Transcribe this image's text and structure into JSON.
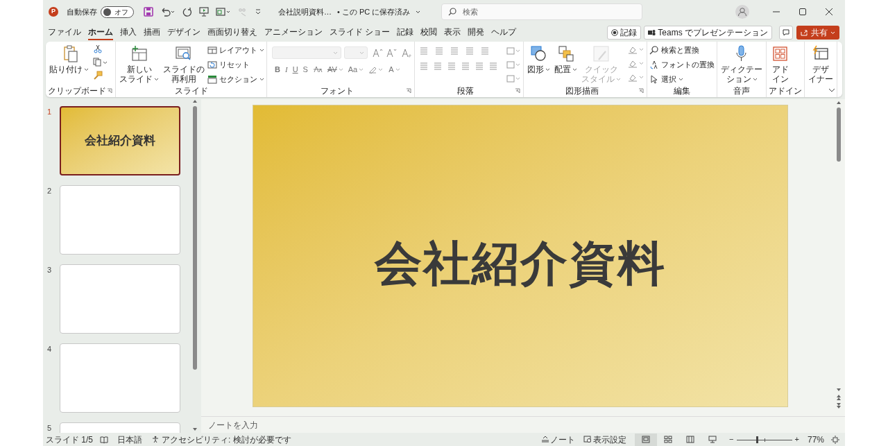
{
  "title_bar": {
    "logo_letter": "P",
    "autosave": {
      "label": "自動保存",
      "on": false,
      "state_label": "オフ"
    },
    "document": {
      "title": "会社説明資料…",
      "save_status": "• この PC に保存済み"
    },
    "search": {
      "placeholder": "検索"
    }
  },
  "tabs": [
    {
      "label": "ファイル",
      "selected": false
    },
    {
      "label": "ホーム",
      "selected": true
    },
    {
      "label": "挿入",
      "selected": false
    },
    {
      "label": "描画",
      "selected": false
    },
    {
      "label": "デザイン",
      "selected": false
    },
    {
      "label": "画面切り替え",
      "selected": false
    },
    {
      "label": "アニメーション",
      "selected": false
    },
    {
      "label": "スライド ショー",
      "selected": false
    },
    {
      "label": "記録",
      "selected": false
    },
    {
      "label": "校閲",
      "selected": false
    },
    {
      "label": "表示",
      "selected": false
    },
    {
      "label": "開発",
      "selected": false
    },
    {
      "label": "ヘルプ",
      "selected": false
    }
  ],
  "ribbon_actions": [
    {
      "kind": "record",
      "label": "記録"
    },
    {
      "kind": "teams",
      "label": "Teams でプレゼンテーション"
    },
    {
      "kind": "comment"
    },
    {
      "kind": "share",
      "label": "共有"
    }
  ],
  "ribbon": {
    "groups": [
      {
        "label": "クリップボード",
        "launcher": true,
        "items": [
          {
            "kind": "large",
            "lines": [
              "貼り付け"
            ],
            "dropdown": true,
            "disabled": false
          },
          {
            "kind": "clipboard_tools"
          }
        ]
      },
      {
        "label": "スライド",
        "launcher": false,
        "items": [
          {
            "kind": "large",
            "lines": [
              "新しい",
              "スライド"
            ],
            "dropdown": true,
            "disabled": false
          },
          {
            "kind": "large",
            "lines": [
              "スライドの",
              "再利用"
            ],
            "dropdown": false,
            "disabled": false
          },
          {
            "kind": "small_column",
            "entries": [
              {
                "label": "レイアウト",
                "dropdown": true
              },
              {
                "label": "リセット",
                "dropdown": false
              },
              {
                "label": "セクション",
                "dropdown": true
              }
            ]
          }
        ]
      },
      {
        "label": "フォント",
        "launcher": true,
        "items": [
          {
            "kind": "font_controls",
            "glyphs": [
              "B",
              "I",
              "U",
              "S",
              "AV",
              "Aa",
              "A"
            ]
          }
        ]
      },
      {
        "label": "段落",
        "launcher": true,
        "items": [
          {
            "kind": "paragraph_controls"
          }
        ]
      },
      {
        "label": "図形描画",
        "launcher": true,
        "items": [
          {
            "kind": "large",
            "lines": [
              "図形"
            ],
            "dropdown": true,
            "disabled": false
          },
          {
            "kind": "large",
            "lines": [
              "配置"
            ],
            "dropdown": true,
            "disabled": false
          },
          {
            "kind": "large",
            "lines": [
              "クイック",
              "スタイル"
            ],
            "dropdown": true,
            "disabled": true
          },
          {
            "kind": "drawing_tools"
          }
        ]
      },
      {
        "label": "編集",
        "launcher": false,
        "items": [
          {
            "kind": "small_column",
            "entries": [
              {
                "label": "検索と置換",
                "dropdown": false
              },
              {
                "label": "フォントの置換",
                "dropdown": false
              },
              {
                "label": "選択",
                "dropdown": true
              }
            ]
          }
        ]
      },
      {
        "label": "音声",
        "launcher": false,
        "items": [
          {
            "kind": "large",
            "lines": [
              "ディクテー",
              "ション"
            ],
            "dropdown": true,
            "disabled": false
          }
        ]
      },
      {
        "label": "アドイン",
        "launcher": false,
        "items": [
          {
            "kind": "large",
            "lines": [
              "アド",
              "イン"
            ],
            "dropdown": false,
            "disabled": false
          }
        ]
      },
      {
        "items": [
          {
            "kind": "large",
            "lines": [
              "デザ",
              "イナー"
            ],
            "dropdown": false,
            "disabled": false
          }
        ]
      }
    ]
  },
  "slides": [
    {
      "number": "1",
      "selected": true,
      "title": "会社紹介資料"
    },
    {
      "number": "2",
      "selected": false
    },
    {
      "number": "3",
      "selected": false
    },
    {
      "number": "4",
      "selected": false
    },
    {
      "number": "5",
      "selected": false
    }
  ],
  "slide": {
    "title": "会社紹介資料"
  },
  "notes": {
    "placeholder": "ノートを入力"
  },
  "status_bar": {
    "slide_counter": "スライド 1/5",
    "language": "日本語",
    "accessibility": "アクセシビリティ: 検討が必要です",
    "notes_button": "ノート",
    "display_settings": "表示設定",
    "views": [
      {
        "selected": true
      },
      {
        "selected": false
      },
      {
        "selected": false
      },
      {
        "selected": false
      }
    ],
    "zoom": {
      "minus": "−",
      "plus": "+",
      "level": 0.38,
      "reading": "77%"
    }
  }
}
